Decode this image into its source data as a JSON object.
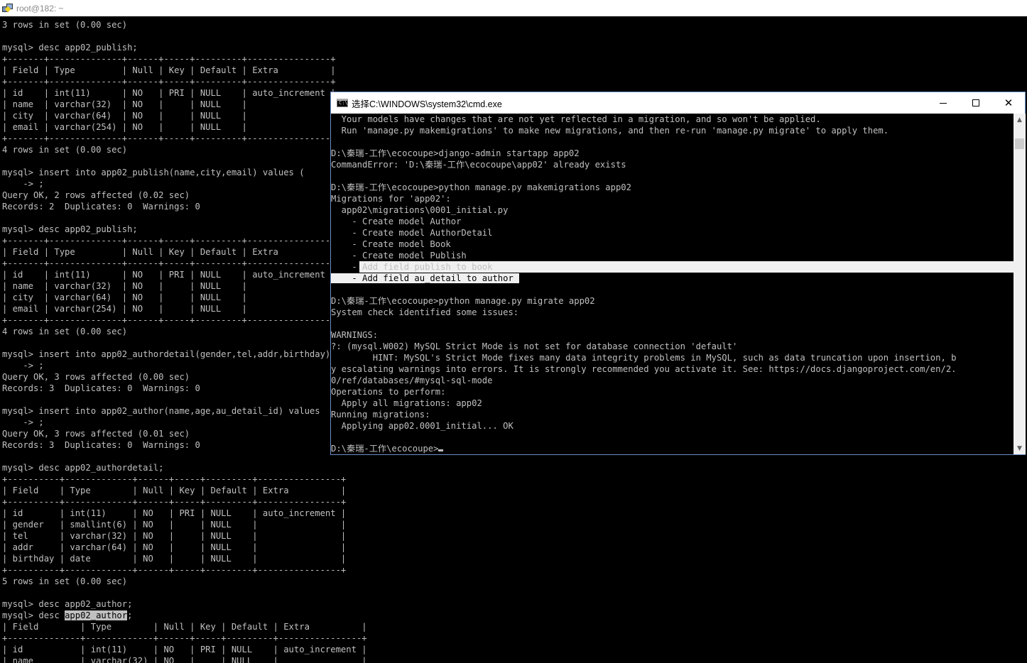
{
  "putty": {
    "title": "root@182: ~",
    "lines": [
      "3 rows in set (0.00 sec)",
      "",
      "mysql> desc app02_publish;",
      "+-------+--------------+------+-----+---------+----------------+",
      "| Field | Type         | Null | Key | Default | Extra          |",
      "+-------+--------------+------+-----+---------+----------------+",
      "| id    | int(11)      | NO   | PRI | NULL    | auto_increment |",
      "| name  | varchar(32)  | NO   |     | NULL    |                |",
      "| city  | varchar(64)  | NO   |     | NULL    |                |",
      "| email | varchar(254) | NO   |     | NULL    |                |",
      "+-------+--------------+------+-----+---------+----------------+",
      "4 rows in set (0.00 sec)",
      "",
      "mysql> insert into app02_publish(name,city,email) values (",
      "    -> ;",
      "Query OK, 2 rows affected (0.02 sec)",
      "Records: 2  Duplicates: 0  Warnings: 0",
      "",
      "mysql> desc app02_publish;",
      "+-------+--------------+------+-----+---------+----------------+",
      "| Field | Type         | Null | Key | Default | Extra          |",
      "+-------+--------------+------+-----+---------+----------------+",
      "| id    | int(11)      | NO   | PRI | NULL    | auto_increment |",
      "| name  | varchar(32)  | NO   |     | NULL    |                |",
      "| city  | varchar(64)  | NO   |     | NULL    |                |",
      "| email | varchar(254) | NO   |     | NULL    |                |",
      "+-------+--------------+------+-----+---------+----------------+",
      "4 rows in set (0.00 sec)",
      "",
      "mysql> insert into app02_authordetail(gender,tel,addr,birthday)",
      "    -> ;",
      "Query OK, 3 rows affected (0.00 sec)",
      "Records: 3  Duplicates: 0  Warnings: 0",
      "",
      "mysql> insert into app02_author(name,age,au_detail_id) values",
      "    -> ;",
      "Query OK, 3 rows affected (0.01 sec)",
      "Records: 3  Duplicates: 0  Warnings: 0",
      "",
      "mysql> desc app02_authordetail;",
      "+----------+-------------+------+-----+---------+----------------+",
      "| Field    | Type        | Null | Key | Default | Extra          |",
      "+----------+-------------+------+-----+---------+----------------+",
      "| id       | int(11)     | NO   | PRI | NULL    | auto_increment |",
      "| gender   | smallint(6) | NO   |     | NULL    |                |",
      "| tel      | varchar(32) | NO   |     | NULL    |                |",
      "| addr     | varchar(64) | NO   |     | NULL    |                |",
      "| birthday | date        | NO   |     | NULL    |                |",
      "+----------+-------------+------+-----+---------+----------------+",
      "5 rows in set (0.00 sec)",
      "",
      "mysql> desc app02_author;",
      "+--------------+-------------+------+-----+---------+----------------+",
      "| Field        | Type        | Null | Key | Default | Extra          |",
      "+--------------+-------------+------+-----+---------+----------------+",
      "| id           | int(11)     | NO   | PRI | NULL    | auto_increment |",
      "| name         | varchar(32) | NO   |     | NULL    |                |"
    ],
    "selection": {
      "line_index": 52,
      "before": "mysql> desc ",
      "selected": "app02_author",
      "after": ";"
    }
  },
  "cmd": {
    "title": "选择C:\\WINDOWS\\system32\\cmd.exe",
    "buttons": {
      "minimize": "",
      "maximize": "",
      "close": "✕"
    },
    "scrollbar": {
      "up": "▲",
      "down": "▼"
    },
    "lines": [
      "  Your models have changes that are not yet reflected in a migration, and so won't be applied.",
      "  Run 'manage.py makemigrations' to make new migrations, and then re-run 'manage.py migrate' to apply them.",
      "",
      "D:\\秦瑞-工作\\ecocoupe>django-admin startapp app02",
      "CommandError: 'D:\\秦瑞-工作\\ecocoupe\\app02' already exists",
      "",
      "D:\\秦瑞-工作\\ecocoupe>python manage.py makemigrations app02",
      "Migrations for 'app02':",
      "  app02\\migrations\\0001_initial.py",
      "    - Create model Author",
      "    - Create model AuthorDetail",
      "    - Create model Book",
      "    - Create model Publish",
      "    - Add field publish to book",
      "    - Add field au_detail to author",
      "",
      "D:\\秦瑞-工作\\ecocoupe>python manage.py migrate app02",
      "System check identified some issues:",
      "",
      "WARNINGS:",
      "?: (mysql.W002) MySQL Strict Mode is not set for database connection 'default'",
      "        HINT: MySQL's Strict Mode fixes many data integrity problems in MySQL, such as data truncation upon insertion, b",
      "y escalating warnings into errors. It is strongly recommended you activate it. See: https://docs.djangoproject.com/en/2.",
      "0/ref/databases/#mysql-sql-mode",
      "Operations to perform:",
      "  Apply all migrations: app02",
      "Running migrations:",
      "  Applying app02.0001_initial... OK",
      "",
      "D:\\秦瑞-工作\\ecocoupe>"
    ],
    "selection": {
      "line13": {
        "before": "    -",
        "selected": " Add field publish to book"
      },
      "line14": {
        "selected": "    - Add field au_detail to author"
      }
    }
  }
}
